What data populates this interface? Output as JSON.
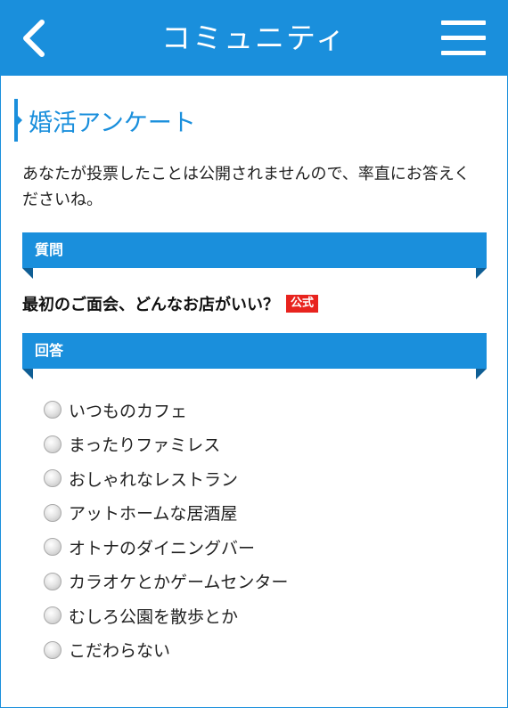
{
  "header": {
    "title": "コミュニティ",
    "back_icon": "chevron-left-icon",
    "menu_icon": "hamburger-menu-icon"
  },
  "page": {
    "heading": "婚活アンケート",
    "intro": "あなたが投票したことは公開されませんので、率直にお答えくださいね。"
  },
  "question_section": {
    "label": "質問",
    "question": "最初のご面会、どんなお店がいい？",
    "badge": "公式"
  },
  "answer_section": {
    "label": "回答",
    "options": [
      {
        "label": "いつものカフェ",
        "selected": false
      },
      {
        "label": "まったりファミレス",
        "selected": false
      },
      {
        "label": "おしゃれなレストラン",
        "selected": false
      },
      {
        "label": "アットホームな居酒屋",
        "selected": false
      },
      {
        "label": "オトナのダイニングバー",
        "selected": false
      },
      {
        "label": "カラオケとかゲームセンター",
        "selected": false
      },
      {
        "label": "むしろ公園を散歩とか",
        "selected": false
      },
      {
        "label": "こだわらない",
        "selected": false
      }
    ]
  },
  "colors": {
    "accent": "#1a8fdc",
    "ribbon_fold": "#0f5e94",
    "badge": "#e8231e",
    "text": "#222222"
  }
}
